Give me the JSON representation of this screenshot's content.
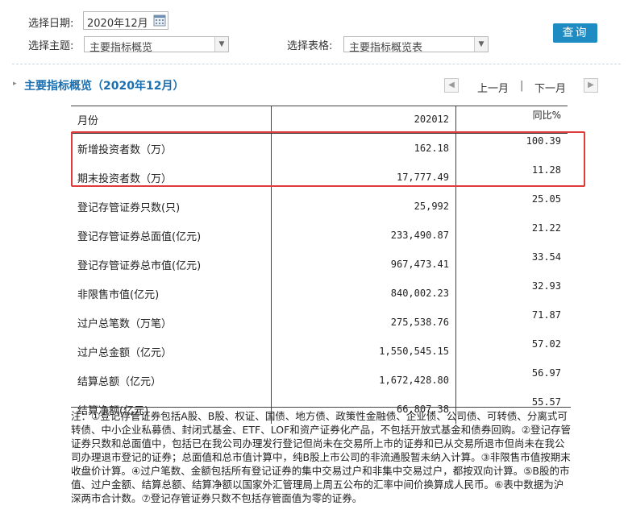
{
  "filters": {
    "date_label": "选择日期:",
    "date_value": "2020年12月",
    "topic_label": "选择主题:",
    "topic_value": "主要指标概览",
    "table_label": "选择表格:",
    "table_value": "主要指标概览表",
    "query_button": "查询"
  },
  "section": {
    "title": "主要指标概览（2020年12月）",
    "prev_month": "上一月",
    "separator": "|",
    "next_month": "下一月"
  },
  "table": {
    "headers": [
      "月份",
      "202012",
      "同比%"
    ],
    "rows": [
      [
        "新增投资者数（万）",
        "162.18",
        "100.39"
      ],
      [
        "期末投资者数（万）",
        "17,777.49",
        "11.28"
      ],
      [
        "登记存管证券只数(只)",
        "25,992",
        "25.05"
      ],
      [
        "登记存管证券总面值(亿元)",
        "233,490.87",
        "21.22"
      ],
      [
        "登记存管证券总市值(亿元)",
        "967,473.41",
        "33.54"
      ],
      [
        "非限售市值(亿元)",
        "840,002.23",
        "32.93"
      ],
      [
        "过户总笔数（万笔）",
        "275,538.76",
        "71.87"
      ],
      [
        "过户总金额（亿元）",
        "1,550,545.15",
        "57.02"
      ],
      [
        "结算总额（亿元）",
        "1,672,428.80",
        "56.97"
      ],
      [
        "结算净额(亿元)",
        "66,807.38",
        "55.57"
      ]
    ]
  },
  "note": "注：①登记存管证券包括A股、B股、权证、国债、地方债、政策性金融债、企业债、公司债、可转债、分离式可转债、中小企业私募债、封闭式基金、ETF、LOF和资产证券化产品，不包括开放式基金和债券回购。②登记存管证券只数和总面值中，包括已在我公司办理发行登记但尚未在交易所上市的证券和已从交易所退市但尚未在我公司办理退市登记的证券；总面值和总市值计算中，纯B股上市公司的非流通股暂未纳入计算。③非限售市值按期末收盘价计算。④过户笔数、金额包括所有登记证券的集中交易过户和非集中交易过户，都按双向计算。⑤B股的市值、过户金额、结算总额、结算净额以国家外汇管理局上周五公布的汇率中间价换算成人民币。⑥表中数据为沪深两市合计数。⑦登记存管证券只数不包括存管面值为零的证券。",
  "colors": {
    "accent": "#1e8bc3",
    "title": "#1a6fb0",
    "highlight": "#e03a3a"
  }
}
